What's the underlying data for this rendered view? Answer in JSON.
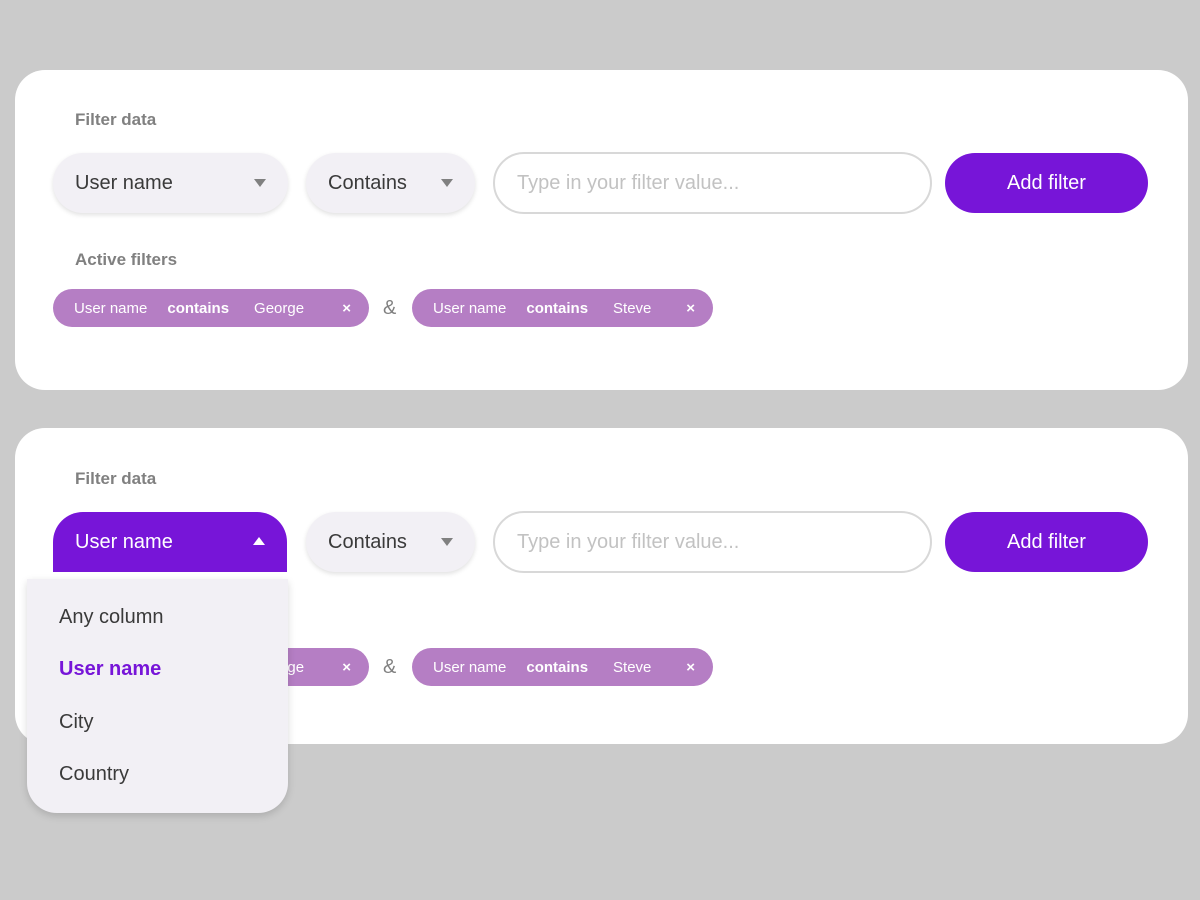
{
  "filter_section_label": "Filter data",
  "active_section_label": "Active filters",
  "column_select": {
    "value": "User name"
  },
  "operator_select": {
    "value": "Contains"
  },
  "filter_input": {
    "placeholder": "Type in your filter value...",
    "value": ""
  },
  "add_button_label": "Add filter",
  "filter_joiner": "&",
  "active_filters": [
    {
      "column": "User name",
      "operator": "contains",
      "value": "George",
      "remove": "×"
    },
    {
      "column": "User name",
      "operator": "contains",
      "value": "Steve",
      "remove": "×"
    }
  ],
  "column_dropdown": {
    "options": [
      "Any column",
      "User name",
      "City",
      "Country"
    ],
    "selected": "User name"
  },
  "colors": {
    "accent": "#7715d8",
    "chip": "#b57ec4",
    "background": "#cbcbcb",
    "card": "#ffffff",
    "select_bg": "#f2f0f5"
  }
}
